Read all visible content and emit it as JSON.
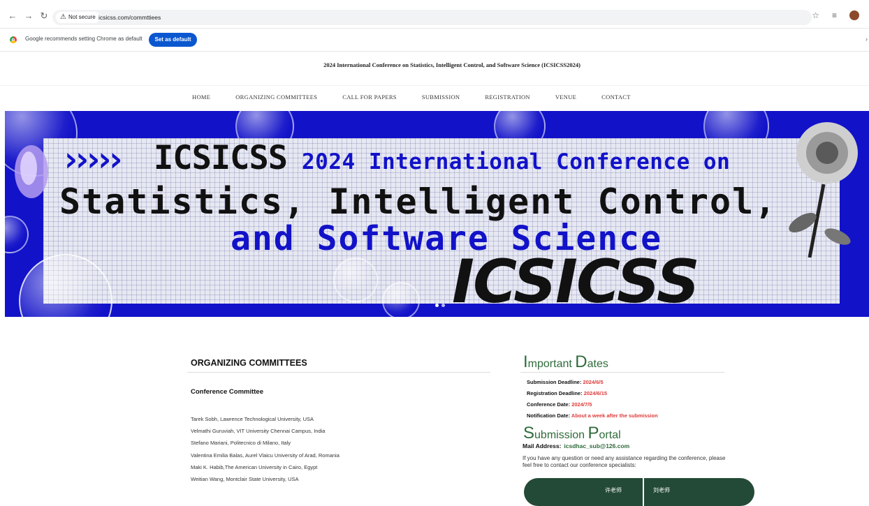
{
  "browser": {
    "url": "icsicss.com/commttiees",
    "security_label": "Not secure",
    "infobar_text": "Google recommends setting Chrome as default",
    "set_default_label": "Set as default"
  },
  "site": {
    "title": "2024 International Conference on Statistics, Intelligent Control, and Software Science (ICSICSS2024)",
    "nav": [
      "HOME",
      "ORGANIZING COMMITTEES",
      "CALL FOR PAPERS",
      "SUBMISSION",
      "REGISTRATION",
      "VENUE",
      "CONTACT"
    ]
  },
  "banner": {
    "brand": "ICSICSS",
    "tagline": "2024 International Conference on",
    "line2": "Statistics, Intelligent Control,",
    "line3": "and Software Science",
    "big_brand": "ICSICSS"
  },
  "committee": {
    "heading": "ORGANIZING COMMITTEES",
    "subheading": "Conference Committee",
    "members": [
      "Tarek Sobh, Lawrence Technological University, USA",
      "Velmathi Guruviah, VIT University Chennai Campus, India",
      "Stefano Mariani, Politecnico di Milano, Italy",
      "Valentina Emilia Balas, Aurel Vlaicu University of Arad, Romania",
      "Maki K. Habib,The American University in Cairo, Egypt",
      "Weitian Wang, Montclair State University, USA"
    ]
  },
  "important_dates": {
    "heading_cap1": "I",
    "heading_rest1": "mportant ",
    "heading_cap2": "D",
    "heading_rest2": "ates",
    "items": [
      {
        "label": "Submission Deadline:",
        "value": "2024/6/5"
      },
      {
        "label": "Registration Deadline:",
        "value": "2024/6/15"
      },
      {
        "label": "Conference Date:",
        "value": "2024/7/5"
      },
      {
        "label": "Notification Date:",
        "value": "About a week after the submission"
      }
    ]
  },
  "submission_portal": {
    "heading_cap1": "S",
    "heading_rest1": "ubmission ",
    "heading_cap2": "P",
    "heading_rest2": "ortal",
    "mail_label": "Mail Address:",
    "mail_value": "icsdhac_sub@126.com",
    "help_text": "If you have any question or need any assistance regarding the conference, please feel free to contact our conference specialists:",
    "contact_a": "许老师",
    "contact_b": "刘老师"
  },
  "colors": {
    "banner_blue": "#1212c9",
    "accent_green": "#2f6b3a",
    "date_red": "#e03a3a",
    "contact_bg": "#234a36",
    "chrome_button": "#0b57d0"
  }
}
